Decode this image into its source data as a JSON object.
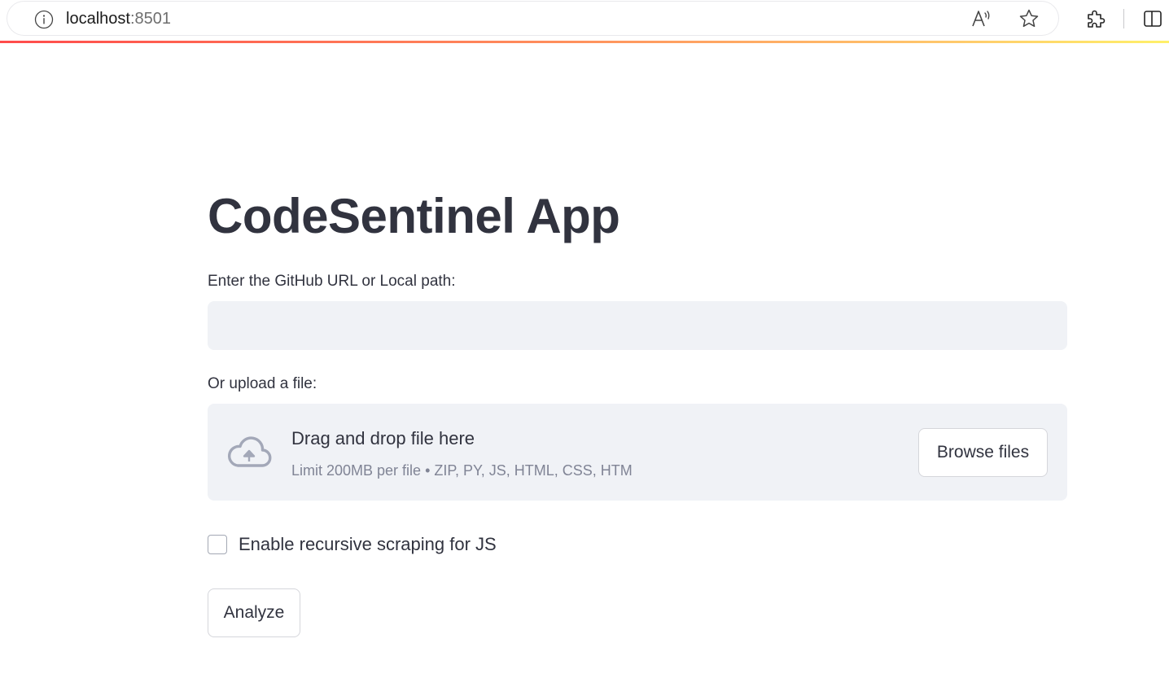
{
  "browser": {
    "url_host": "localhost",
    "url_port": ":8501",
    "icons": {
      "info": "info-icon",
      "read_aloud": "read-aloud-icon",
      "favorite": "star-icon",
      "extensions": "puzzle-icon",
      "split_screen": "split-screen-icon"
    },
    "accent_gradient": [
      "#ff4b4b",
      "#ff8a5b",
      "#ffc66b",
      "#fff06a"
    ]
  },
  "app": {
    "title": "CodeSentinel App",
    "url_input": {
      "label": "Enter the GitHub URL or Local path:",
      "value": "",
      "placeholder": ""
    },
    "uploader": {
      "label": "Or upload a file:",
      "icon": "cloud-upload-icon",
      "title": "Drag and drop file here",
      "limit_text": "Limit 200MB per file • ZIP, PY, JS, HTML, CSS, HTM",
      "browse_label": "Browse files"
    },
    "recursive_checkbox": {
      "label": "Enable recursive scraping for JS",
      "checked": false
    },
    "analyze_label": "Analyze"
  },
  "colors": {
    "text": "#31333f",
    "muted_text": "#808495",
    "field_background": "#f0f2f6",
    "border": "#d5d6db"
  }
}
